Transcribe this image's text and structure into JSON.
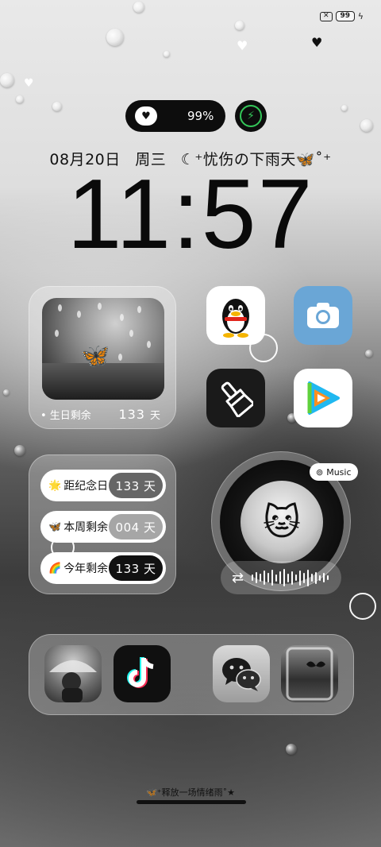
{
  "status_bar": {
    "sim_status": "✕",
    "battery_level": "99"
  },
  "pill": {
    "battery_percent": "99%"
  },
  "dateline": {
    "date": "08月20日",
    "weekday": "周三",
    "motto": "☾⁺忧伤の下雨天🦋˚⁺"
  },
  "clock": {
    "time": "11:57"
  },
  "photo_widget": {
    "label": "• 生日剩余",
    "value": "133",
    "unit": "天"
  },
  "countdown": {
    "rows": [
      {
        "emoji": "🌟",
        "label": "距纪念日",
        "value": "133 天"
      },
      {
        "emoji": "🦋",
        "label": "本周剩余",
        "value": "004 天"
      },
      {
        "emoji": "🌈",
        "label": "今年剩余",
        "value": "133 天"
      }
    ]
  },
  "music": {
    "tag": "Music"
  },
  "footer": {
    "text": "🦋⁺释放一场情绪雨˚★"
  },
  "apps": [
    "QQ",
    "相机",
    "清理",
    "腾讯视频",
    "相册",
    "抖音",
    "微信",
    "图库"
  ],
  "icons": [
    "x-box-icon",
    "battery-icon",
    "bolt-icon",
    "heart-icon",
    "charging-icon",
    "qq-penguin-icon",
    "camera-icon",
    "brush-icon",
    "video-play-icon",
    "netease-icon",
    "shuffle-icon",
    "tiktok-icon",
    "wechat-icon"
  ],
  "colors": {
    "charging_green": "#34c759",
    "camera_blue": "#6aa6d6",
    "pill_black": "#0d0d0d"
  }
}
